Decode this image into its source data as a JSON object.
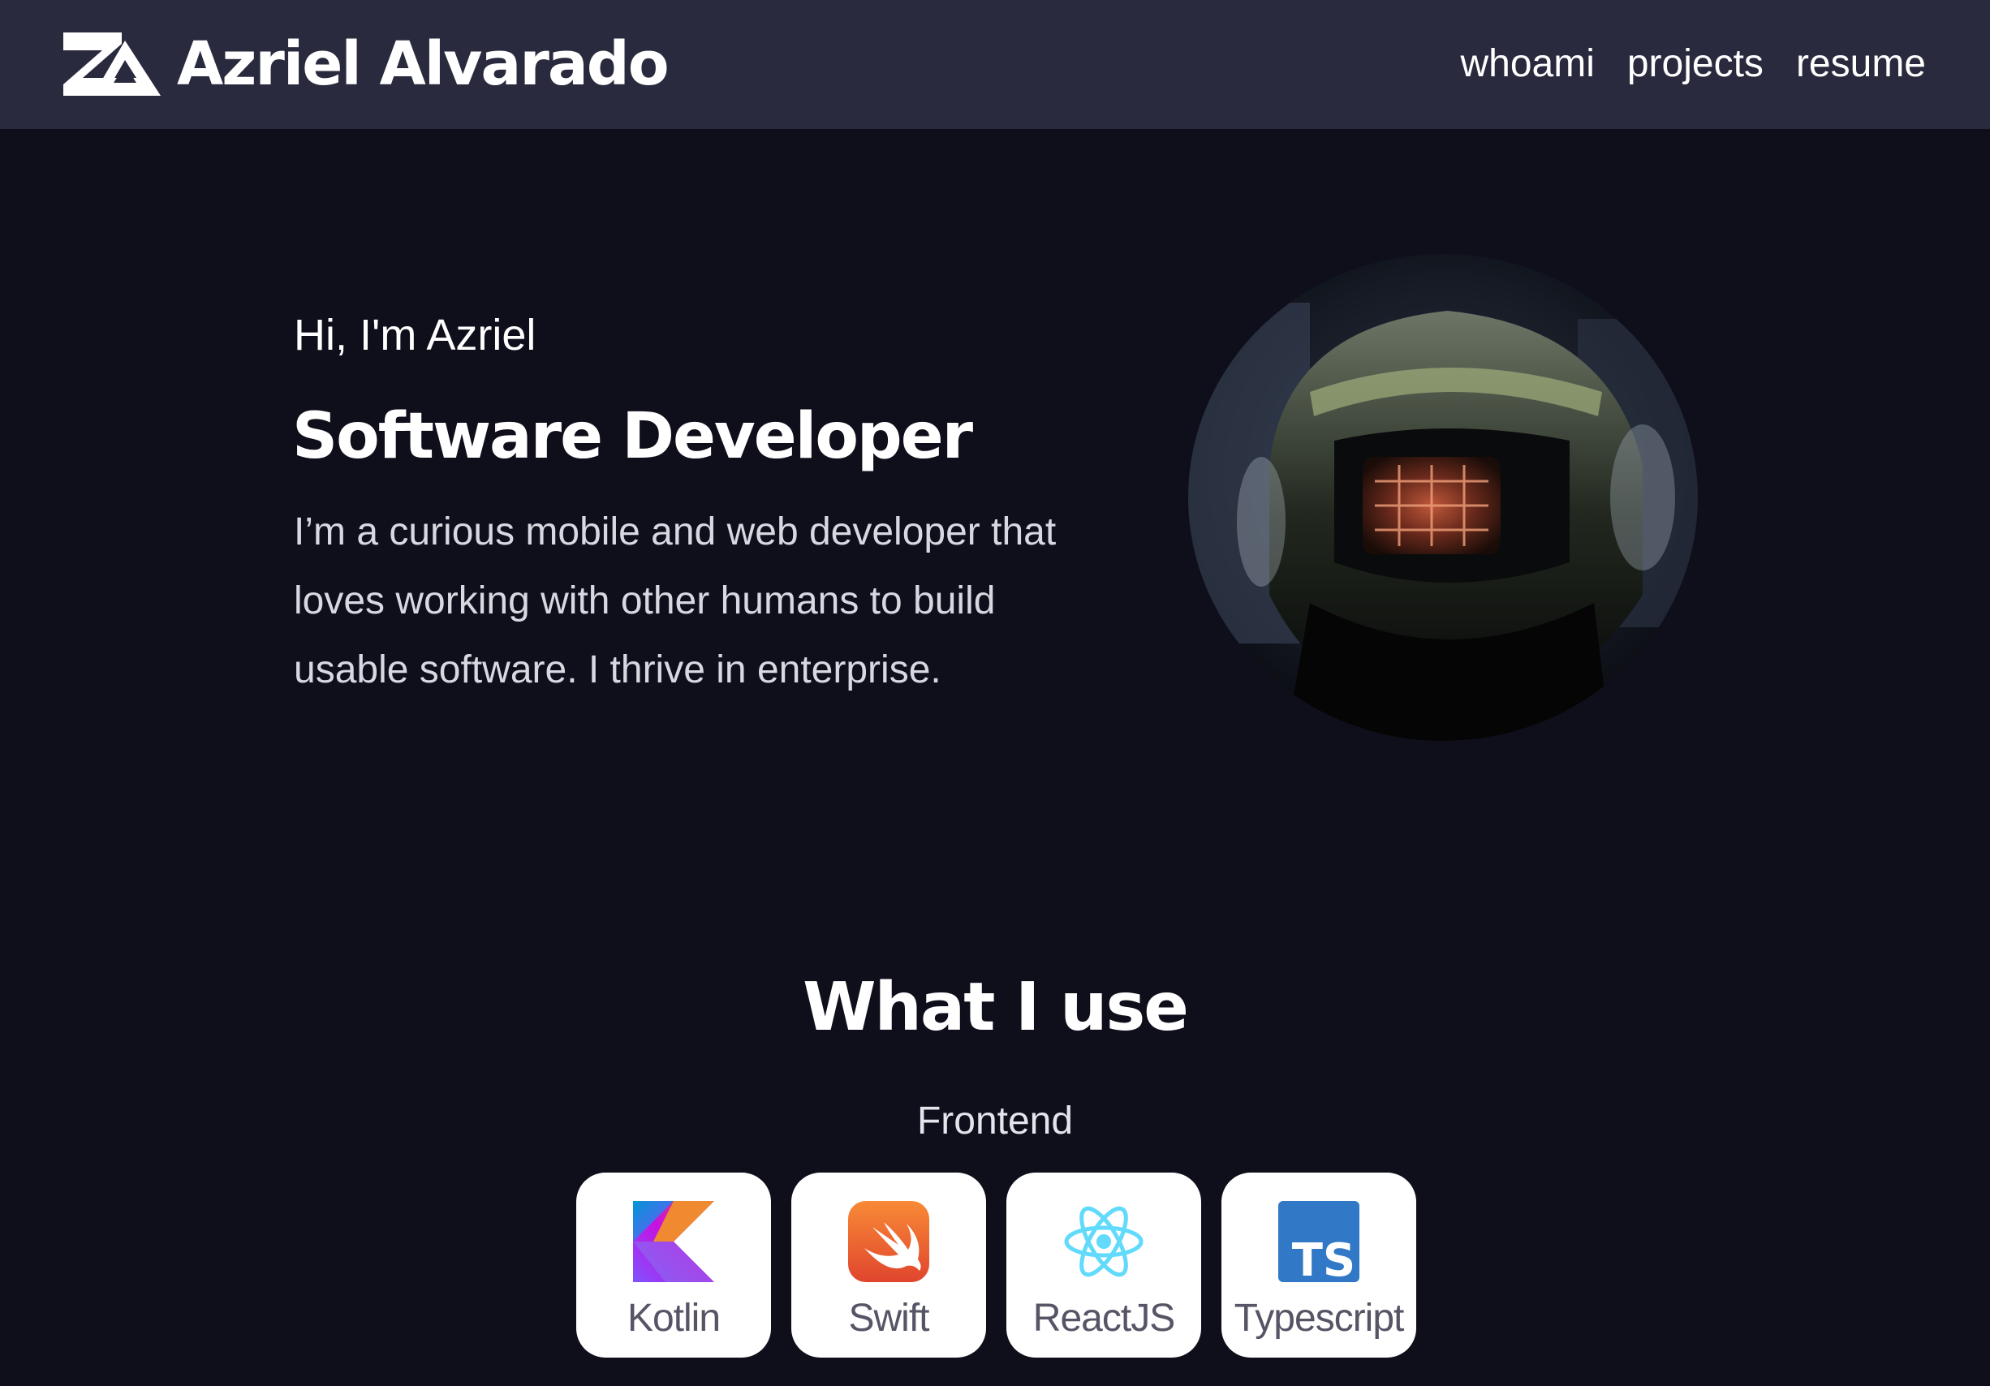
{
  "header": {
    "brand": "Azriel Alvarado",
    "logo_icon": "az-monogram-icon",
    "nav": [
      {
        "label": "whoami"
      },
      {
        "label": "projects"
      },
      {
        "label": "resume"
      }
    ]
  },
  "hero": {
    "greeting": "Hi, I'm Azriel",
    "role": "Software Developer",
    "bio": "I’m a curious mobile and web developer that loves working with other humans to build usable software. I thrive in enterprise.",
    "avatar_icon": "helmet-reflection-photo"
  },
  "skills": {
    "title": "What I use",
    "categories": [
      {
        "name": "Frontend",
        "items": [
          {
            "label": "Kotlin",
            "icon": "kotlin-icon"
          },
          {
            "label": "Swift",
            "icon": "swift-icon"
          },
          {
            "label": "ReactJS",
            "icon": "react-icon"
          },
          {
            "label": "Typescript",
            "icon": "typescript-icon",
            "icon_text": "TS"
          }
        ]
      }
    ]
  },
  "colors": {
    "background": "#0f0f1c",
    "navbar": "#292a3d",
    "card": "#ffffff",
    "text": "#ffffff",
    "typescript_blue": "#3178c6",
    "react_cyan": "#61dafb"
  }
}
